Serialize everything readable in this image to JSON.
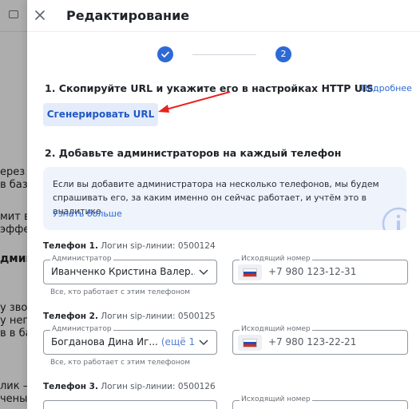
{
  "background": {
    "lines": [
      "ерез М",
      "в базе",
      "мит вр",
      "эффе",
      "дминис",
      "у звон",
      "у него",
      "в в ба",
      "лик —",
      "чены."
    ]
  },
  "header": {
    "title": "Редактирование"
  },
  "stepper": {
    "step2_label": "2"
  },
  "section1": {
    "title": "1. Скопируйте URL и укажите его в настройках HTTP UIS",
    "more_link": "Подробнее",
    "generate_button": "Сгенерировать URL"
  },
  "section2": {
    "title": "2. Добавьте администраторов на каждый телефон",
    "info_text": "Если вы добавите администратора на несколько телефонов, мы будем спрашивать его, за каким именно он сейчас работает, и учтём это в аналитике",
    "info_link": "Узнать больше"
  },
  "phones": [
    {
      "label": "Телефон 1.",
      "login": "Логин sip-линии: 0500124",
      "admin_legend": "Администратор",
      "admin_value": "Иванченко Кристина Валер...",
      "admin_extra": "",
      "number_legend": "Исходящий номер",
      "number_value": "+7 980 123-12-31",
      "hint": "Все, кто работает с этим телефоном"
    },
    {
      "label": "Телефон 2.",
      "login": "Логин sip-линии: 0500125",
      "admin_legend": "Администратор",
      "admin_value": "Богданова Дина Иг...",
      "admin_extra": "(ещё 1)",
      "number_legend": "Исходящий номер",
      "number_value": "+7 980 123-22-21",
      "hint": "Все, кто работает с этим телефоном"
    },
    {
      "label": "Телефон 3.",
      "login": "Логин sip-линии: 0500126",
      "number_legend": "Исходящий номер"
    }
  ],
  "colors": {
    "accent": "#2d6ad6",
    "arrow": "#e8231f",
    "info_bg": "#eef3fc"
  }
}
